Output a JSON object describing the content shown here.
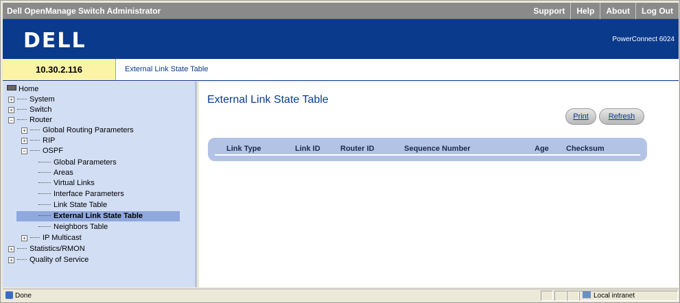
{
  "app": {
    "title": "Dell OpenManage Switch Administrator",
    "nav": [
      "Support",
      "Help",
      "About",
      "Log Out"
    ],
    "logo": "DELL",
    "model": "PowerConnect 6024"
  },
  "info": {
    "ip": "10.30.2.116",
    "breadcrumb": "External Link State Table"
  },
  "tree": {
    "home": "Home",
    "items": [
      {
        "label": "System",
        "toggle": "+"
      },
      {
        "label": "Switch",
        "toggle": "+"
      },
      {
        "label": "Router",
        "toggle": "−"
      },
      {
        "label": "Global Routing Parameters",
        "toggle": "+"
      },
      {
        "label": "RIP",
        "toggle": "+"
      },
      {
        "label": "OSPF",
        "toggle": "−"
      },
      {
        "label": "Global Parameters"
      },
      {
        "label": "Areas"
      },
      {
        "label": "Virtual Links"
      },
      {
        "label": "Interface Parameters"
      },
      {
        "label": "Link State Table"
      },
      {
        "label": "External Link State Table"
      },
      {
        "label": "Neighbors Table"
      },
      {
        "label": "IP Multicast",
        "toggle": "+"
      },
      {
        "label": "Statistics/RMON",
        "toggle": "+"
      },
      {
        "label": "Quality of Service",
        "toggle": "+"
      }
    ]
  },
  "main": {
    "title": "External Link State Table",
    "print_label": "Print",
    "refresh_label": "Refresh",
    "columns": [
      "Link Type",
      "Link ID",
      "Router ID",
      "Sequence Number",
      "Age",
      "Checksum"
    ]
  },
  "status": {
    "text": "Done",
    "zone": "Local intranet"
  },
  "colors": {
    "banner": "#0a3a8c",
    "tree_bg": "#d2def4",
    "selected": "#8fa8de",
    "ip_box": "#fbf3a6"
  }
}
